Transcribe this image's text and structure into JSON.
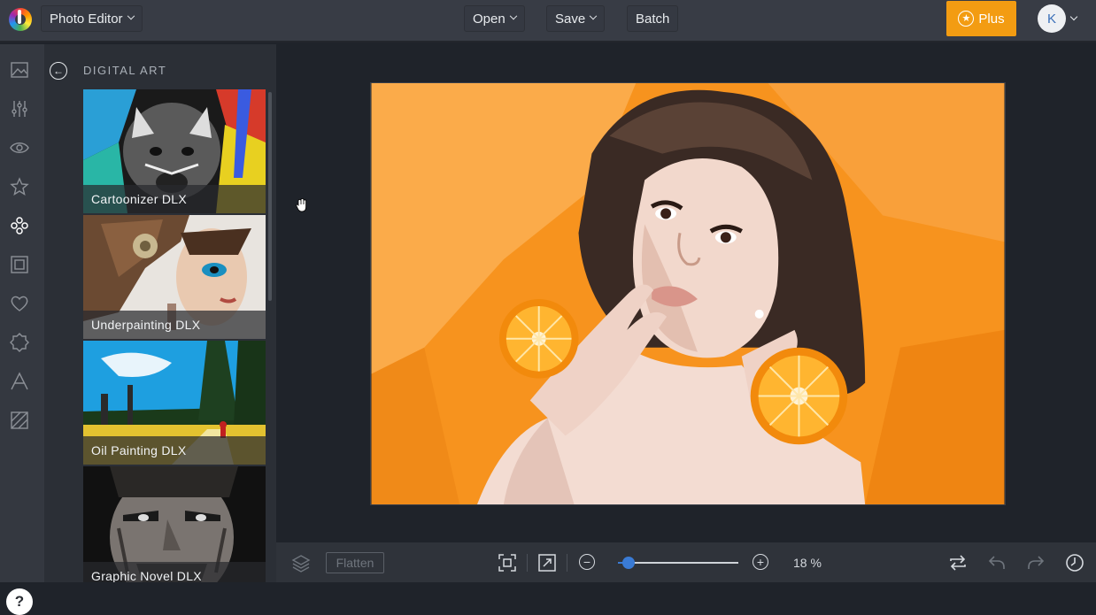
{
  "header": {
    "app_menu_label": "Photo Editor",
    "open_label": "Open",
    "save_label": "Save",
    "batch_label": "Batch",
    "plus_label": "Plus",
    "avatar_initial": "K"
  },
  "rail": {
    "icons": [
      "image-icon",
      "sliders-icon",
      "eye-icon",
      "star-icon",
      "effects-icon",
      "frame-icon",
      "heart-icon",
      "badge-icon",
      "text-icon",
      "texture-icon"
    ],
    "active": "effects-icon",
    "help_label": "?"
  },
  "panel": {
    "title": "DIGITAL ART",
    "effects": [
      {
        "label": "Cartoonizer DLX"
      },
      {
        "label": "Underpainting DLX"
      },
      {
        "label": "Oil Painting DLX"
      },
      {
        "label": "Graphic Novel DLX"
      }
    ]
  },
  "bottombar": {
    "flatten_label": "Flatten",
    "zoom_minus": "−",
    "zoom_plus": "+",
    "zoom_text": "18 %",
    "zoom_level": 0.18
  },
  "colors": {
    "accent": "#f39c12",
    "slider": "#3a7bd5",
    "photo_background": "#f7931e"
  }
}
